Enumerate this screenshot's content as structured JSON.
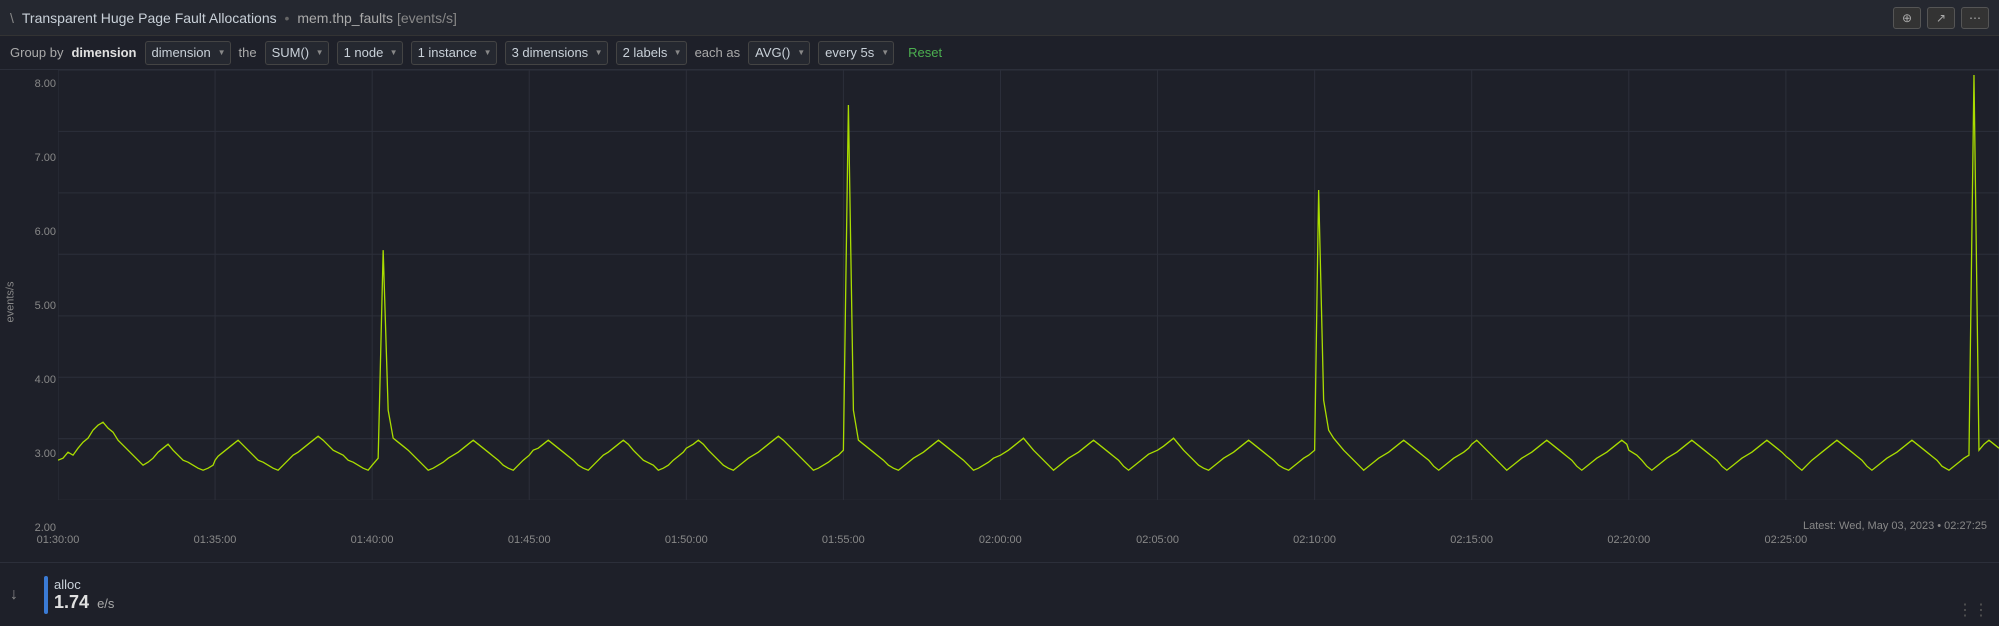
{
  "header": {
    "icon": "\\",
    "title": "Transparent Huge Page Fault Allocations",
    "separator": "•",
    "metric": "mem.thp_faults",
    "unit": "[events/s]",
    "buttons": [
      {
        "label": "⊕",
        "name": "add-button"
      },
      {
        "label": "↗",
        "name": "expand-button"
      },
      {
        "label": "⋯",
        "name": "more-button"
      }
    ]
  },
  "toolbar": {
    "group_by_label": "Group by",
    "dimension_label": "dimension",
    "the_label": "the",
    "sum_label": "SUM()",
    "node_value": "1 node",
    "instance_value": "1 instance",
    "dimensions_value": "3 dimensions",
    "labels_value": "2 labels",
    "each_as_label": "each as",
    "avg_label": "AVG()",
    "every_label": "every 5s",
    "reset_label": "Reset"
  },
  "y_axis": {
    "label": "events/s",
    "ticks": [
      "8.00",
      "7.00",
      "6.00",
      "5.00",
      "4.00",
      "3.00",
      "2.00"
    ]
  },
  "x_axis": {
    "ticks": [
      "01:30:00",
      "01:35:00",
      "01:40:00",
      "01:45:00",
      "01:50:00",
      "01:55:00",
      "02:00:00",
      "02:05:00",
      "02:10:00",
      "02:15:00",
      "02:20:00",
      "02:25:00"
    ]
  },
  "legend": {
    "down_icon": "↓",
    "item": {
      "name": "alloc",
      "value": "1.74",
      "unit": "e/s",
      "color": "#3a7bd5"
    }
  },
  "latest": {
    "label": "Latest: Wed, May 03, 2023 • 02:27:25"
  },
  "chart": {
    "line_color": "#aadd00",
    "grid_color": "#2c2f3a",
    "bg_color": "#1e2029"
  }
}
